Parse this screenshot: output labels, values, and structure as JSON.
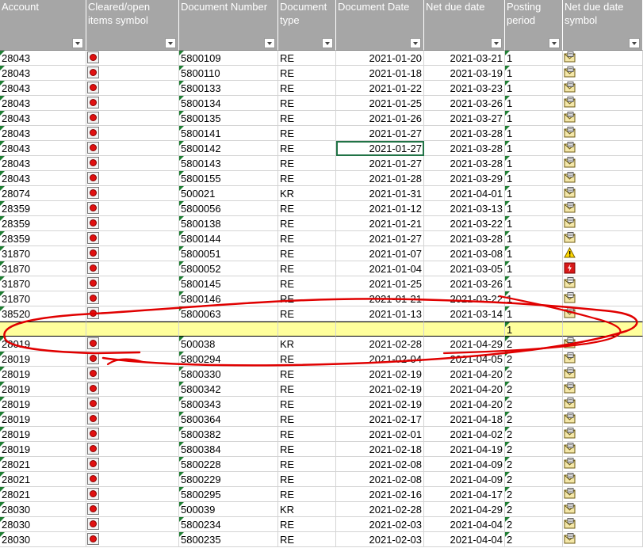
{
  "columns": [
    {
      "key": "account",
      "label": "Account"
    },
    {
      "key": "cleared",
      "label": "Cleared/open items symbol"
    },
    {
      "key": "docnum",
      "label": "Document Number"
    },
    {
      "key": "doctype",
      "label": "Document type"
    },
    {
      "key": "docdate",
      "label": "Document Date"
    },
    {
      "key": "duedate",
      "label": "Net due date"
    },
    {
      "key": "period",
      "label": "Posting period"
    },
    {
      "key": "duesym",
      "label": "Net due date symbol"
    }
  ],
  "rows": [
    {
      "account": "28043",
      "docnum": "5800109",
      "doctype": "RE",
      "docdate": "2021-01-20",
      "duedate": "2021-03-21",
      "period": "1",
      "duesym": "envelope"
    },
    {
      "account": "28043",
      "docnum": "5800110",
      "doctype": "RE",
      "docdate": "2021-01-18",
      "duedate": "2021-03-19",
      "period": "1",
      "duesym": "envelope"
    },
    {
      "account": "28043",
      "docnum": "5800133",
      "doctype": "RE",
      "docdate": "2021-01-22",
      "duedate": "2021-03-23",
      "period": "1",
      "duesym": "envelope"
    },
    {
      "account": "28043",
      "docnum": "5800134",
      "doctype": "RE",
      "docdate": "2021-01-25",
      "duedate": "2021-03-26",
      "period": "1",
      "duesym": "envelope"
    },
    {
      "account": "28043",
      "docnum": "5800135",
      "doctype": "RE",
      "docdate": "2021-01-26",
      "duedate": "2021-03-27",
      "period": "1",
      "duesym": "envelope"
    },
    {
      "account": "28043",
      "docnum": "5800141",
      "doctype": "RE",
      "docdate": "2021-01-27",
      "duedate": "2021-03-28",
      "period": "1",
      "duesym": "envelope"
    },
    {
      "account": "28043",
      "docnum": "5800142",
      "doctype": "RE",
      "docdate": "2021-01-27",
      "duedate": "2021-03-28",
      "period": "1",
      "duesym": "envelope",
      "selected": "docdate"
    },
    {
      "account": "28043",
      "docnum": "5800143",
      "doctype": "RE",
      "docdate": "2021-01-27",
      "duedate": "2021-03-28",
      "period": "1",
      "duesym": "envelope"
    },
    {
      "account": "28043",
      "docnum": "5800155",
      "doctype": "RE",
      "docdate": "2021-01-28",
      "duedate": "2021-03-29",
      "period": "1",
      "duesym": "envelope"
    },
    {
      "account": "28074",
      "docnum": "500021",
      "doctype": "KR",
      "docdate": "2021-01-31",
      "duedate": "2021-04-01",
      "period": "1",
      "duesym": "envelope"
    },
    {
      "account": "28359",
      "docnum": "5800056",
      "doctype": "RE",
      "docdate": "2021-01-12",
      "duedate": "2021-03-13",
      "period": "1",
      "duesym": "envelope"
    },
    {
      "account": "28359",
      "docnum": "5800138",
      "doctype": "RE",
      "docdate": "2021-01-21",
      "duedate": "2021-03-22",
      "period": "1",
      "duesym": "envelope"
    },
    {
      "account": "28359",
      "docnum": "5800144",
      "doctype": "RE",
      "docdate": "2021-01-27",
      "duedate": "2021-03-28",
      "period": "1",
      "duesym": "envelope"
    },
    {
      "account": "31870",
      "docnum": "5800051",
      "doctype": "RE",
      "docdate": "2021-01-07",
      "duedate": "2021-03-08",
      "period": "1",
      "duesym": "warning"
    },
    {
      "account": "31870",
      "docnum": "5800052",
      "doctype": "RE",
      "docdate": "2021-01-04",
      "duedate": "2021-03-05",
      "period": "1",
      "duesym": "overdue"
    },
    {
      "account": "31870",
      "docnum": "5800145",
      "doctype": "RE",
      "docdate": "2021-01-25",
      "duedate": "2021-03-26",
      "period": "1",
      "duesym": "envelope"
    },
    {
      "account": "31870",
      "docnum": "5800146",
      "doctype": "RE",
      "docdate": "2021-01-21",
      "duedate": "2021-03-22",
      "period": "1",
      "duesym": "envelope"
    },
    {
      "account": "38520",
      "docnum": "5800063",
      "doctype": "RE",
      "docdate": "2021-01-13",
      "duedate": "2021-03-14",
      "period": "1",
      "duesym": "envelope"
    },
    {
      "account": "",
      "docnum": "",
      "doctype": "",
      "docdate": "",
      "duedate": "",
      "period": "1",
      "duesym": "",
      "yellow": true
    },
    {
      "account": "28019",
      "docnum": "500038",
      "doctype": "KR",
      "docdate": "2021-02-28",
      "duedate": "2021-04-29",
      "period": "2",
      "duesym": "envelope"
    },
    {
      "account": "28019",
      "docnum": "5800294",
      "doctype": "RE",
      "docdate": "2021-02-04",
      "duedate": "2021-04-05",
      "period": "2",
      "duesym": "envelope"
    },
    {
      "account": "28019",
      "docnum": "5800330",
      "doctype": "RE",
      "docdate": "2021-02-19",
      "duedate": "2021-04-20",
      "period": "2",
      "duesym": "envelope"
    },
    {
      "account": "28019",
      "docnum": "5800342",
      "doctype": "RE",
      "docdate": "2021-02-19",
      "duedate": "2021-04-20",
      "period": "2",
      "duesym": "envelope"
    },
    {
      "account": "28019",
      "docnum": "5800343",
      "doctype": "RE",
      "docdate": "2021-02-19",
      "duedate": "2021-04-20",
      "period": "2",
      "duesym": "envelope"
    },
    {
      "account": "28019",
      "docnum": "5800364",
      "doctype": "RE",
      "docdate": "2021-02-17",
      "duedate": "2021-04-18",
      "period": "2",
      "duesym": "envelope"
    },
    {
      "account": "28019",
      "docnum": "5800382",
      "doctype": "RE",
      "docdate": "2021-02-01",
      "duedate": "2021-04-02",
      "period": "2",
      "duesym": "envelope"
    },
    {
      "account": "28019",
      "docnum": "5800384",
      "doctype": "RE",
      "docdate": "2021-02-18",
      "duedate": "2021-04-19",
      "period": "2",
      "duesym": "envelope"
    },
    {
      "account": "28021",
      "docnum": "5800228",
      "doctype": "RE",
      "docdate": "2021-02-08",
      "duedate": "2021-04-09",
      "period": "2",
      "duesym": "envelope"
    },
    {
      "account": "28021",
      "docnum": "5800229",
      "doctype": "RE",
      "docdate": "2021-02-08",
      "duedate": "2021-04-09",
      "period": "2",
      "duesym": "envelope"
    },
    {
      "account": "28021",
      "docnum": "5800295",
      "doctype": "RE",
      "docdate": "2021-02-16",
      "duedate": "2021-04-17",
      "period": "2",
      "duesym": "envelope"
    },
    {
      "account": "28030",
      "docnum": "500039",
      "doctype": "KR",
      "docdate": "2021-02-28",
      "duedate": "2021-04-29",
      "period": "2",
      "duesym": "envelope"
    },
    {
      "account": "28030",
      "docnum": "5800234",
      "doctype": "RE",
      "docdate": "2021-02-03",
      "duedate": "2021-04-04",
      "period": "2",
      "duesym": "envelope"
    },
    {
      "account": "28030",
      "docnum": "5800235",
      "doctype": "RE",
      "docdate": "2021-02-03",
      "duedate": "2021-04-04",
      "period": "2",
      "duesym": "envelope"
    }
  ],
  "colors": {
    "header_bg": "#a6a6a6",
    "highlight_row": "#ffff9c",
    "annotation": "#e00000",
    "selection": "#217346",
    "cleared_symbol": "#e01010"
  }
}
